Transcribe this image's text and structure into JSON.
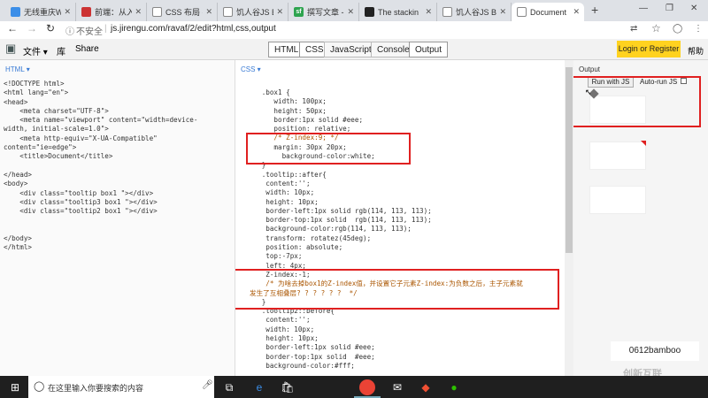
{
  "browser": {
    "tabs": [
      {
        "title": "无线重庆Wi",
        "fav_color": "#3b8ee8"
      },
      {
        "title": "前端：从入门",
        "fav_color": "#c33"
      },
      {
        "title": "CSS 布局 -",
        "fav_color": "#888"
      },
      {
        "title": "饥人谷JS Bi",
        "fav_color": "#888"
      },
      {
        "title": "撰写文章 -",
        "fav_color": "#2ea44f"
      },
      {
        "title": "The stackin",
        "fav_color": "#222"
      },
      {
        "title": "饥人谷JS Bi",
        "fav_color": "#888"
      },
      {
        "title": "Document",
        "fav_color": "#888"
      }
    ],
    "new_tab": "+",
    "window_controls": {
      "minimize": "—",
      "restore": "❐",
      "close": "✕"
    },
    "nav": {
      "back": "←",
      "forward": "→",
      "reload": "↻"
    },
    "security": "不安全",
    "url": "js.jirengu.com/ravaf/2/edit?html,css,output",
    "extra_icons": {
      "translate": "⇄",
      "star": "☆",
      "account": "◯",
      "menu": "⋮"
    }
  },
  "app": {
    "logo": "▣",
    "menu": {
      "file": "文件 ▾",
      "library": "库",
      "share": "Share"
    },
    "panels": [
      {
        "label": "HTML",
        "active": true
      },
      {
        "label": "CSS",
        "active": true
      },
      {
        "label": "JavaScript",
        "active": false
      },
      {
        "label": "Console",
        "active": false
      },
      {
        "label": "Output",
        "active": true
      }
    ],
    "login": "Login or Register",
    "help": "帮助"
  },
  "html_pane": {
    "label": "HTML ▾",
    "lines": [
      "<!DOCTYPE html>",
      "<html lang=\"en\">",
      "<head>",
      "    <meta charset=\"UTF-8\">",
      "    <meta name=\"viewport\" content=\"width=device-",
      "width, initial-scale=1.0\">",
      "    <meta http-equiv=\"X-UA-Compatible\"",
      "content=\"ie=edge\">",
      "    <title>Document</title>",
      "",
      "</head>",
      "<body>",
      "    <div class=\"tooltip box1 \"></div>",
      "    <div class=\"tooltip3 box1 \"></div>",
      "    <div class=\"tooltip2 box1 \"></div>",
      "",
      "",
      "</body>",
      "</html>"
    ]
  },
  "css_pane": {
    "label": "CSS ▾",
    "lines": [
      "   .box1 {",
      "      width: 100px;",
      "      height: 50px;",
      "      border:1px solid #eee;",
      "      position: relative;",
      "      /* Z-index:9; */",
      "      margin: 30px 20px;",
      "        background-color:white;",
      "   }",
      "   .tooltip::after{",
      "    content:'';",
      "    width: 10px;",
      "    height: 10px;",
      "    border-left:1px solid rgb(114, 113, 113);",
      "    border-top:1px solid  rgb(114, 113, 113);",
      "    background-color:rgb(114, 113, 113);",
      "    transform: rotatez(45deg);",
      "    position: absolute;",
      "    top:-7px;",
      "    left: 4px;",
      "    Z-index:-1;",
      "    /* 为啥去掉box1的Z-index值，并设置它子元素Z-index:为负数之后，主子元素就",
      "发生了互相叠层? ? ? ? ? ?  */",
      "   }",
      "   .tooltip2::before{",
      "    content:'';",
      "    width: 10px;",
      "    height: 10px;",
      "    border-left:1px solid #eee;",
      "    border-top:1px solid  #eee;",
      "    background-color:#fff;"
    ]
  },
  "output_pane": {
    "label": "Output",
    "run_button": "Run with JS",
    "auto_run": "Auto-run JS",
    "auto_run_checked": false
  },
  "colors": {
    "highlight_box": "#e02020",
    "login_bg": "#ffd21f"
  },
  "watermark": {
    "user": "0612bamboo",
    "brand": "创新互联"
  },
  "taskbar": {
    "search_placeholder": "在这里输入你要搜索的内容",
    "icons": [
      "windows-icon",
      "cortana-icon",
      "mic-icon",
      "task-view-icon",
      "edge-icon",
      "store-icon",
      "chrome-icon",
      "mail-icon",
      "git-icon",
      "wechat-icon"
    ]
  }
}
